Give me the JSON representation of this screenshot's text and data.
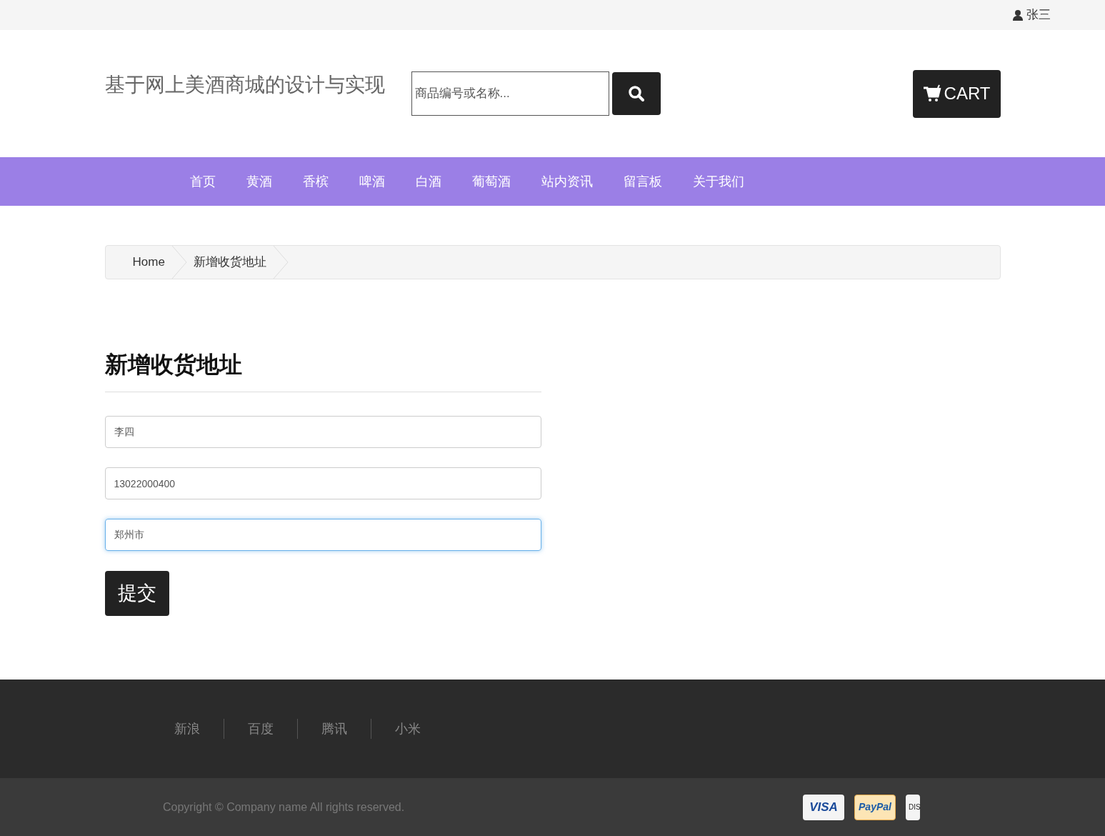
{
  "top_bar": {
    "user": "张三"
  },
  "header": {
    "site_title": "基于网上美酒商城的设计与实现",
    "search": {
      "placeholder": "商品编号或名称..."
    },
    "cart": "CART"
  },
  "nav": [
    "首页",
    "黄酒",
    "香槟",
    "啤酒",
    "白酒",
    "葡萄酒",
    "站内资讯",
    "留言板",
    "关于我们"
  ],
  "breadcrumb": [
    "Home",
    "新增收货地址"
  ],
  "form": {
    "title": "新增收货地址",
    "fields": [
      {
        "value": "李四",
        "focused": false
      },
      {
        "value": "13022000400",
        "focused": false
      },
      {
        "value": "郑州市",
        "focused": true
      }
    ],
    "submit": "提交"
  },
  "footer": {
    "links": [
      "新浪",
      "百度",
      "腾讯",
      "小米"
    ],
    "copyright": "Copyright © Company name All rights reserved.",
    "payments": [
      {
        "label": "VISA",
        "kind": "visa"
      },
      {
        "label": "PayPal",
        "kind": "paypal"
      },
      {
        "label": "DIS",
        "kind": "discover"
      }
    ]
  }
}
